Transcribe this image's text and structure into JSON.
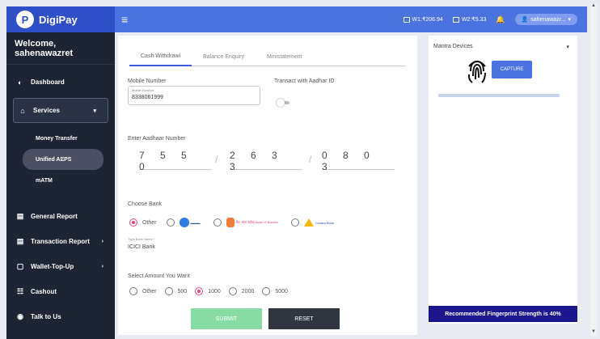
{
  "brand": {
    "name": "DigiPay",
    "logo_letter": "P"
  },
  "topbar": {
    "wallet1": "W1:₹206.94",
    "wallet2": "W2:₹5.33",
    "user": "sahenawazr..."
  },
  "sidebar": {
    "welcome": "Welcome, sahenawazret",
    "items": [
      {
        "label": "Dashboard",
        "icon": "dashboard-icon"
      },
      {
        "label": "Services",
        "icon": "services-icon"
      },
      {
        "label": "General Report",
        "icon": "report-icon"
      },
      {
        "label": "Transaction Report",
        "icon": "report-icon"
      },
      {
        "label": "Wallet-Top-Up",
        "icon": "wallet-icon"
      },
      {
        "label": "Cashout",
        "icon": "cashout-icon"
      },
      {
        "label": "Talk to Us",
        "icon": "support-icon"
      }
    ],
    "subitems": [
      "Money Transfer",
      "Unified AEPS",
      "mATM"
    ]
  },
  "tabs": [
    "Cash Withdrawl",
    "Balance Enquiry",
    "Ministatement"
  ],
  "form": {
    "mobile_label": "Mobile Number",
    "mobile_value": "8338061999",
    "transact_label": "Transact with Aadhar ID",
    "aadhaar_label": "Enter Aadhaar Number",
    "aadhaar": [
      "7 5 5 0",
      "2 6 3 3",
      "0 8 0 3"
    ],
    "choose_bank_label": "Choose Bank",
    "bank_other": "Other",
    "bank_bob": "बैंक ऑफ़ बड़ौदा Bank of Baroda",
    "bank_canara": "Canara Bank",
    "type_bank_label": "Type Bank Name *",
    "bank_name_value": "ICICI Bank",
    "amount_label": "Select Amount You Want",
    "amounts": [
      "Other",
      "500",
      "1000",
      "2000",
      "5000"
    ],
    "selected_amount": "1000",
    "submit": "SUBMIT",
    "reset": "RESET"
  },
  "right_panel": {
    "devices_label": "Mantra Devices",
    "capture": "CAPTURE",
    "strength": "Recommended Fingerprint Strength is 40%"
  },
  "colors": {
    "primary": "#4b73e0",
    "sidebar": "#1d2433",
    "accent": "#e0457b",
    "strength_bar": "#1c168c"
  }
}
